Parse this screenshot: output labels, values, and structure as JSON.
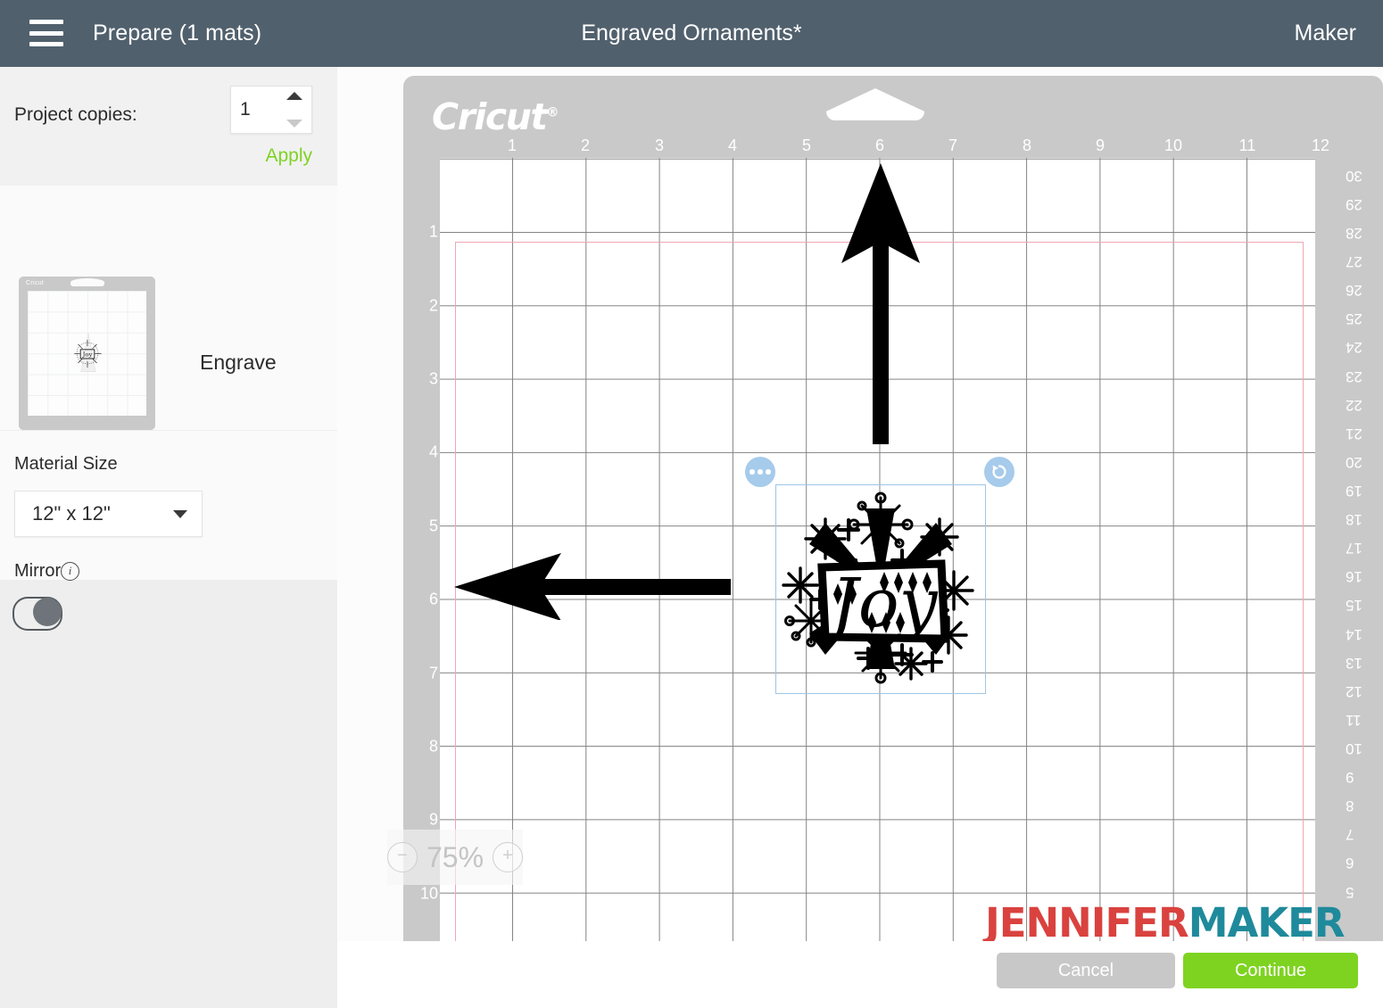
{
  "header": {
    "menu_icon": "hamburger-menu-icon",
    "screen_title": "Prepare (1 mats)",
    "project_title": "Engraved Ornaments*",
    "machine": "Maker",
    "bg_color": "#51606d"
  },
  "sidebar": {
    "copies_label": "Project copies:",
    "copies_value": "1",
    "apply_label": "Apply",
    "apply_color": "#7ed321",
    "operation_label": "Engrave",
    "material_size_label": "Material Size",
    "material_size_value": "12\" x 12\"",
    "mirror_label": "Mirror",
    "mirror_info_icon": "info-icon",
    "mirror_state": "off",
    "mat_thumbnail_brand": "Cricut"
  },
  "canvas": {
    "mat_brand": "Cricut",
    "trademark": "®",
    "ruler_top": [
      "1",
      "2",
      "3",
      "4",
      "5",
      "6",
      "7",
      "8",
      "9",
      "10",
      "11",
      "12"
    ],
    "ruler_left": [
      "1",
      "2",
      "3",
      "4",
      "5",
      "6",
      "7",
      "8",
      "9",
      "10"
    ],
    "ruler_right": [
      "30",
      "29",
      "28",
      "27",
      "26",
      "25",
      "24",
      "23",
      "22",
      "21",
      "20",
      "19",
      "18",
      "17",
      "16",
      "15",
      "14",
      "13",
      "12",
      "11",
      "10",
      "9",
      "8",
      "7",
      "6",
      "5"
    ],
    "zoom_level": "75%",
    "zoom_out_label": "−",
    "zoom_in_label": "+",
    "mat_color": "#c9c9c9",
    "grid_color": "#6e6e6e",
    "cut_boundary_color": "#f0a7b4"
  },
  "selection": {
    "design_name": "Joy ornament",
    "design_text": "Joy",
    "more_handle_icon": "more-options-icon",
    "rotate_handle_icon": "rotate-icon",
    "handle_color": "#a6cbeb",
    "box_color": "#9fc6e8"
  },
  "annotations": {
    "arrow_up": "up-arrow-annotation",
    "arrow_left": "left-arrow-annotation",
    "color": "#000000"
  },
  "watermark": {
    "part_one": "JENNIFER",
    "part_two": "MAKER",
    "color_one": "#d9423f",
    "color_two": "#1f8a9b"
  },
  "footer": {
    "cancel_label": "Cancel",
    "continue_label": "Continue",
    "continue_color": "#7ed321",
    "cancel_color": "#c8c8c8"
  }
}
